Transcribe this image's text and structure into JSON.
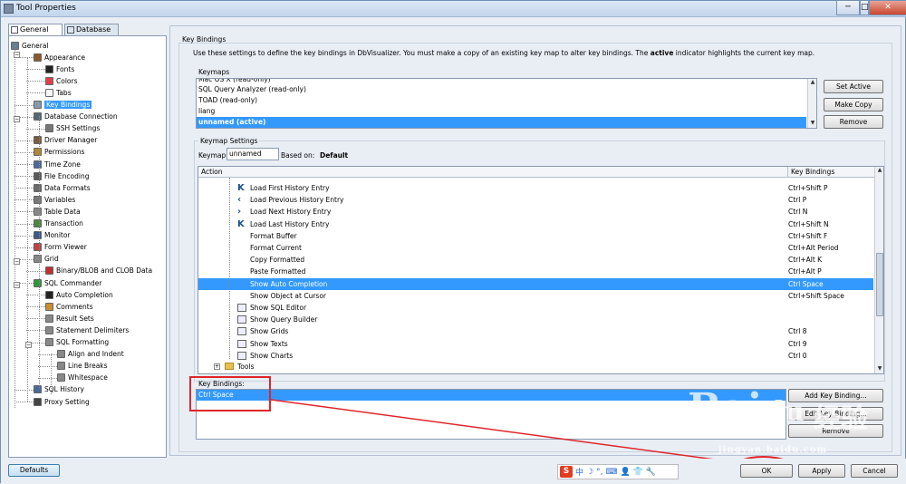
{
  "window": {
    "title": "Tool Properties",
    "min": "─",
    "max": "□",
    "close": "✕"
  },
  "tabs": [
    "General",
    "Database"
  ],
  "tree": [
    {
      "label": "General",
      "icon": "general-icon",
      "color": "#6a7c96"
    },
    {
      "label": "Appearance",
      "icon": "appearance-icon",
      "color": "#8a5a2a"
    },
    {
      "label": "Fonts",
      "icon": "fonts-icon",
      "color": "#222"
    },
    {
      "label": "Colors",
      "icon": "colors-icon",
      "color": "#e0404a"
    },
    {
      "label": "Tabs",
      "icon": "tabs-icon",
      "color": "#fff"
    },
    {
      "label": "Key Bindings",
      "icon": "key-bindings-icon",
      "color": "#8899aa"
    },
    {
      "label": "Database Connection",
      "icon": "database-connection-icon",
      "color": "#556677"
    },
    {
      "label": "SSH Settings",
      "icon": "ssh-settings-icon",
      "color": "#777"
    },
    {
      "label": "Driver Manager",
      "icon": "driver-manager-icon",
      "color": "#7a5a3a"
    },
    {
      "label": "Permissions",
      "icon": "permissions-icon",
      "color": "#b08a30"
    },
    {
      "label": "Time Zone",
      "icon": "time-zone-icon",
      "color": "#4a6a9a"
    },
    {
      "label": "File Encoding",
      "icon": "file-encoding-icon",
      "color": "#5a5a5a"
    },
    {
      "label": "Data Formats",
      "icon": "data-formats-icon",
      "color": "#6a6a6a"
    },
    {
      "label": "Variables",
      "icon": "variables-icon",
      "color": "#777"
    },
    {
      "label": "Table Data",
      "icon": "table-data-icon",
      "color": "#888"
    },
    {
      "label": "Transaction",
      "icon": "transaction-icon",
      "color": "#4a8a3a"
    },
    {
      "label": "Monitor",
      "icon": "monitor-icon",
      "color": "#3a5a8a"
    },
    {
      "label": "Form Viewer",
      "icon": "form-viewer-icon",
      "color": "#c04040"
    },
    {
      "label": "Grid",
      "icon": "grid-icon",
      "color": "#888"
    },
    {
      "label": "Binary/BLOB and CLOB Data",
      "icon": "binary-blob-icon",
      "color": "#c03030"
    },
    {
      "label": "SQL Commander",
      "icon": "sql-commander-icon",
      "color": "#2a9a3a"
    },
    {
      "label": "Auto Completion",
      "icon": "auto-completion-icon",
      "color": "#222"
    },
    {
      "label": "Comments",
      "icon": "comments-icon",
      "color": "#c89030"
    },
    {
      "label": "Result Sets",
      "icon": "result-sets-icon",
      "color": "#888"
    },
    {
      "label": "Statement Delimiters",
      "icon": "statement-delimiters-icon",
      "color": "#888"
    },
    {
      "label": "SQL Formatting",
      "icon": "sql-formatting-icon",
      "color": "#888"
    },
    {
      "label": "Align and Indent",
      "icon": "align-indent-icon",
      "color": "#888"
    },
    {
      "label": "Line Breaks",
      "icon": "line-breaks-icon",
      "color": "#888"
    },
    {
      "label": "Whitespace",
      "icon": "whitespace-icon",
      "color": "#888"
    },
    {
      "label": "SQL History",
      "icon": "sql-history-icon",
      "color": "#4a6a9a"
    },
    {
      "label": "Proxy Setting",
      "icon": "proxy-setting-icon",
      "color": "#444"
    }
  ],
  "key_bindings": {
    "group_title": "Key Bindings",
    "description_pre": "Use these settings to define the key bindings in DbVisualizer. You must make a copy of an existing key map to alter key bindings. The ",
    "description_bold": "active",
    "description_post": " indicator highlights the current key map.",
    "keymaps_label": "Keymaps",
    "keymaps": [
      "Mac OS X  (read-only)",
      "SQL Query Analyzer  (read-only)",
      "TOAD  (read-only)",
      "liang",
      "unnamed  (active)"
    ],
    "set_active": "Set Active",
    "make_copy": "Make Copy",
    "remove": "Remove",
    "keymap_settings_label": "Keymap Settings",
    "keymap_field_label": "Keymap:",
    "keymap_value": "unnamed",
    "based_on_label": "Based on:",
    "based_on_value": "Default",
    "col_action": "Action",
    "col_bindings": "Key Bindings",
    "actions": [
      {
        "name": "Load First History Entry",
        "keys": "Ctrl+Shift P",
        "icon": "first-history-icon"
      },
      {
        "name": "Load Previous History Entry",
        "keys": "Ctrl P",
        "icon": "previous-history-icon"
      },
      {
        "name": "Load Next History Entry",
        "keys": "Ctrl N",
        "icon": "next-history-icon"
      },
      {
        "name": "Load Last History Entry",
        "keys": "Ctrl+Shift N",
        "icon": "last-history-icon"
      },
      {
        "name": "Format Buffer",
        "keys": "Ctrl+Shift F",
        "icon": ""
      },
      {
        "name": "Format Current",
        "keys": "Ctrl+Alt Period",
        "icon": ""
      },
      {
        "name": "Copy Formatted",
        "keys": "Ctrl+Alt K",
        "icon": ""
      },
      {
        "name": "Paste Formatted",
        "keys": "Ctrl+Alt P",
        "icon": ""
      },
      {
        "name": "Show Auto Completion",
        "keys": "Ctrl Space",
        "icon": ""
      },
      {
        "name": "Show Object at Cursor",
        "keys": "Ctrl+Shift Space",
        "icon": ""
      },
      {
        "name": "Show SQL Editor",
        "keys": "",
        "icon": "sql-editor-icon"
      },
      {
        "name": "Show Query Builder",
        "keys": "",
        "icon": "query-builder-icon"
      },
      {
        "name": "Show Grids",
        "keys": "Ctrl 8",
        "icon": "grids-icon"
      },
      {
        "name": "Show Texts",
        "keys": "Ctrl 9",
        "icon": "texts-icon"
      },
      {
        "name": "Show Charts",
        "keys": "Ctrl 0",
        "icon": "charts-icon"
      }
    ],
    "tools_node": "Tools",
    "bindings_label": "Key Bindings:",
    "bindings_value": "Ctrl Space",
    "add_binding": "Add Key Binding...",
    "edit_binding": "Edit Key Binding...",
    "remove_binding": "Remove"
  },
  "footer": {
    "defaults": "Defaults",
    "ok": "OK",
    "apply": "Apply",
    "cancel": "Cancel"
  },
  "watermark": {
    "brand": "Bai",
    "paw": "du",
    "suffix": "经验",
    "url": "jingyan.baidu.com"
  },
  "ime_toolbar": [
    "S",
    "中",
    "☽",
    "°,",
    "⌨",
    "👤",
    "👕",
    "🔧"
  ]
}
